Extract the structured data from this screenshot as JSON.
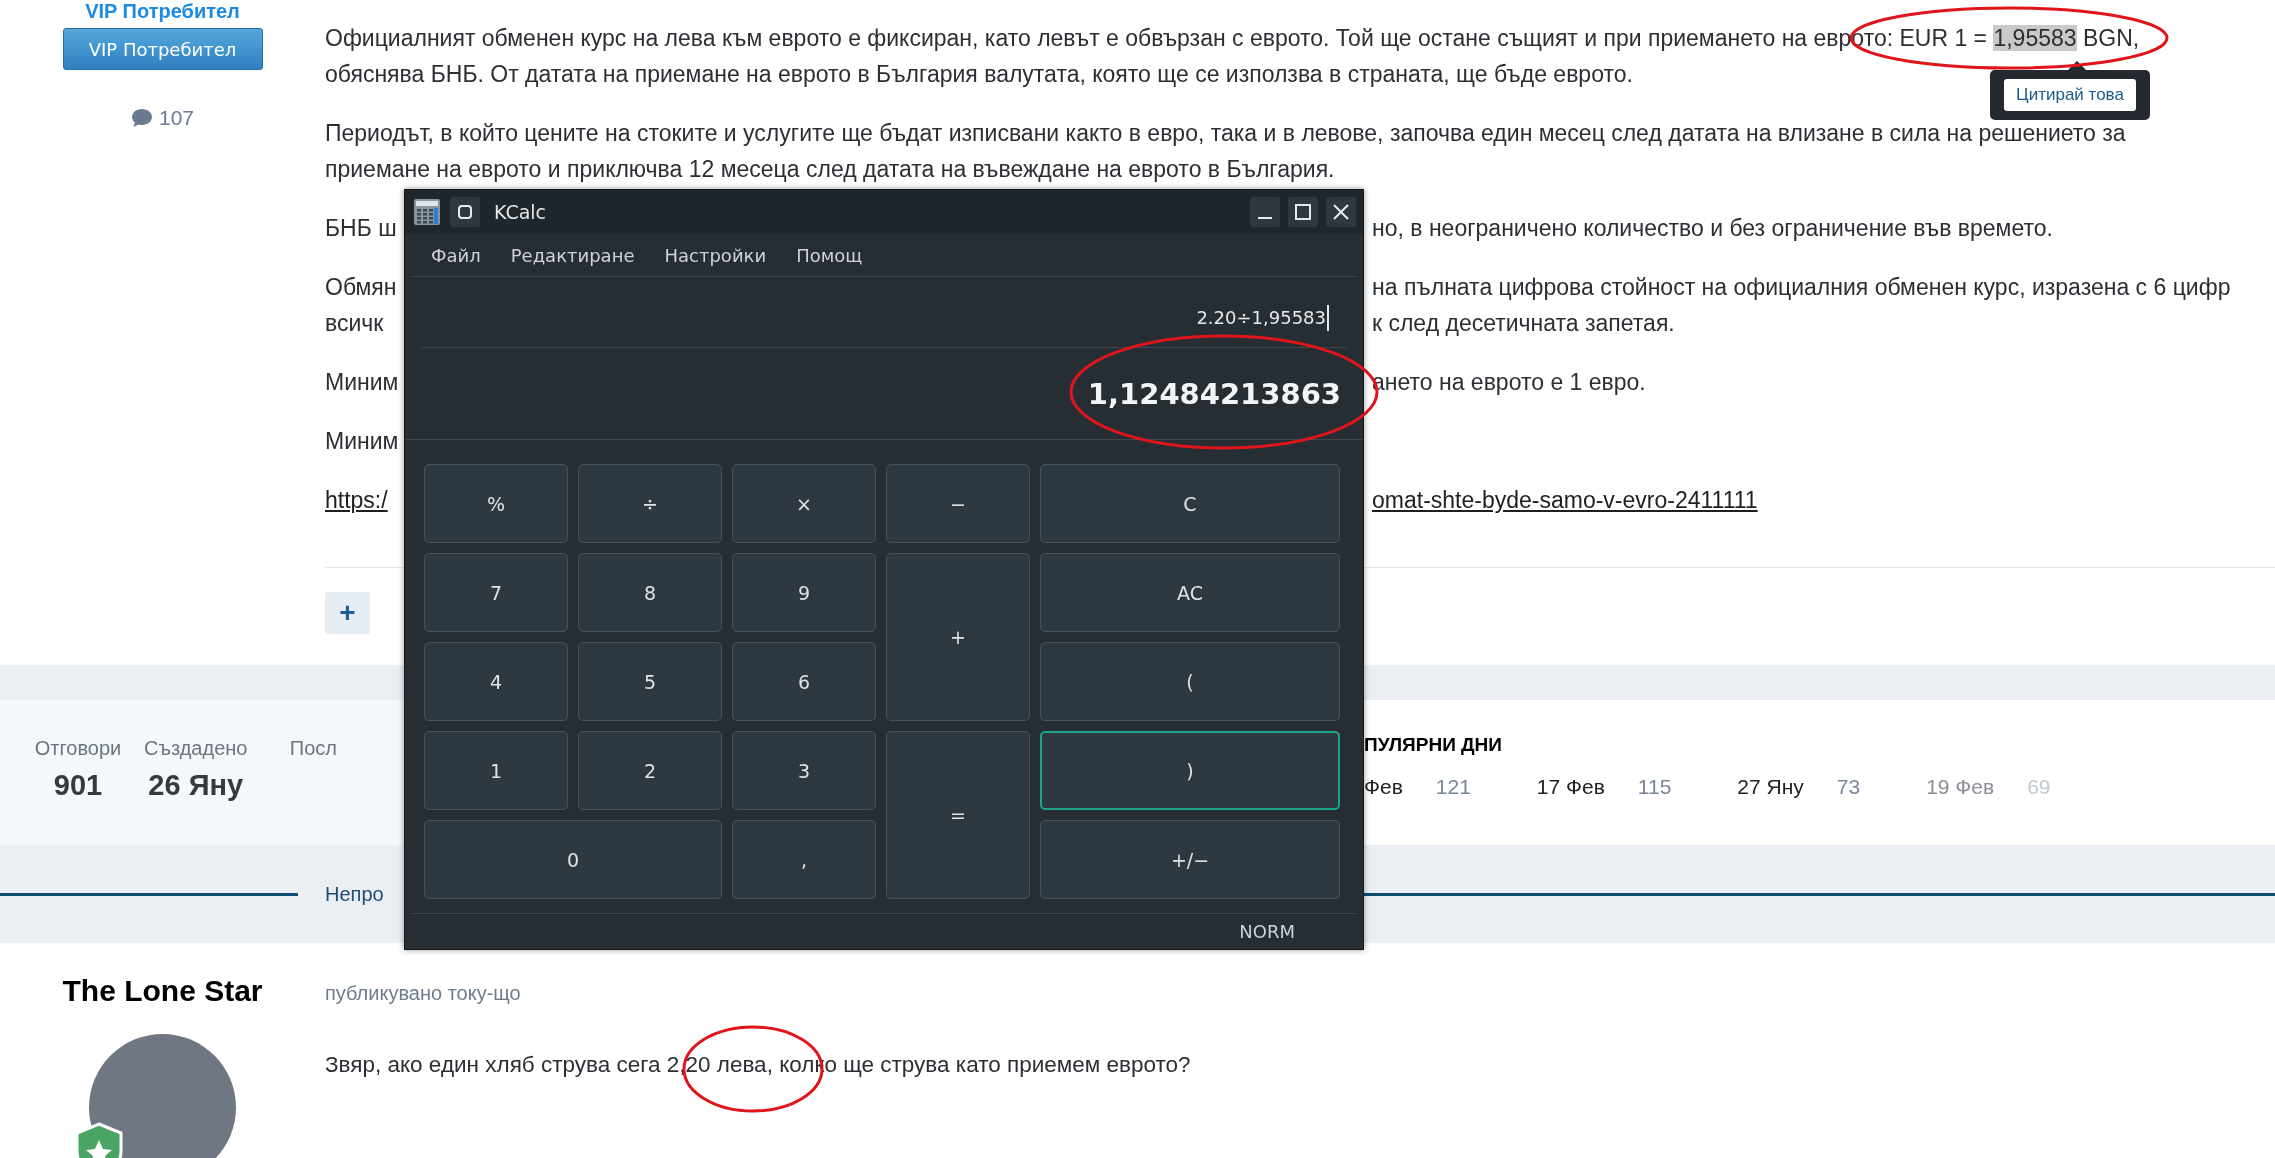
{
  "sidebar": {
    "rank_title": "VIP Потребител",
    "rank_badge": "VIP Потребител",
    "comment_count": "107"
  },
  "article": {
    "paragraphs": [
      {
        "lines": [
          {
            "kind": "highlighted",
            "text": "Официалният обменен курс на лева към еврото е фиксиран, като левът е обвързан с еврото. Той ще остане същият и при приемането на еврото: EUR 1 = ",
            "highlight": "1,95583",
            "after": " BGN,"
          },
          {
            "kind": "full",
            "text": "обяснява БНБ. От датата на приемане на еврото в България валутата, която ще се използва в страната, ще бъде еврото."
          }
        ]
      },
      {
        "lines": [
          {
            "kind": "full",
            "text": "Периодът, в който цените на стоките и услугите ще бъдат изписвани както в евро, така и в левове, започва един месец след датата на влизане в сила на решението за"
          },
          {
            "kind": "full",
            "text": "приемане на еврото и приключва 12 месеца след датата на въвеждане на еврото в България."
          }
        ]
      },
      {
        "lines": [
          {
            "kind": "split",
            "left": "БНБ ш",
            "right": "но, в неограничено количество и без ограничение във времето."
          }
        ]
      },
      {
        "lines": [
          {
            "kind": "split",
            "left": "Обмян",
            "right": "на пълната цифрова стойност на официалния обменен курс, изразена с 6 цифр"
          },
          {
            "kind": "split",
            "left": "всичк",
            "right": "к след десетичната запетая."
          }
        ]
      },
      {
        "lines": [
          {
            "kind": "split",
            "left": "Миним",
            "right": "ането на еврото е 1 евро."
          }
        ]
      },
      {
        "lines": [
          {
            "kind": "split",
            "left": "Миним"
          }
        ]
      },
      {
        "lines": [
          {
            "kind": "link",
            "left": "https:/",
            "right": "omat-shte-byde-samo-v-evro-2411111"
          }
        ]
      }
    ],
    "add_button": "+"
  },
  "quote_tooltip": {
    "button": "Цитирай това"
  },
  "stats": [
    {
      "label": "Отговори",
      "value": "901"
    },
    {
      "label": "Създадено",
      "value": "26 Яну"
    },
    {
      "label": "Посл"
    }
  ],
  "popular_days": {
    "title": "ПУЛЯРНИ ДНИ",
    "days": [
      {
        "date": "Фев",
        "count": "121"
      },
      {
        "date": "17 Фев",
        "count": "115"
      },
      {
        "date": "27 Яну",
        "count": "73"
      },
      {
        "date": "19 Фев",
        "count": "69"
      }
    ]
  },
  "tab": {
    "label": "Непро"
  },
  "reply": {
    "author": "The Lone Star",
    "time": "публикувано току-що",
    "text": "Звяр, ако един хляб струва сега 2,20 лева, колко ще струва като приемем еврото?"
  },
  "calculator": {
    "title": "KCalc",
    "menu": [
      "Файл",
      "Редактиране",
      "Настройки",
      "Помощ"
    ],
    "expression": "2.20÷1,95583",
    "result": "1,12484213863",
    "keys": [
      {
        "label": "%",
        "kind": "normal",
        "focused": false
      },
      {
        "label": "÷",
        "kind": "normal",
        "focused": false
      },
      {
        "label": "×",
        "kind": "normal",
        "focused": false
      },
      {
        "label": "−",
        "kind": "normal",
        "focused": false
      },
      {
        "label": "C",
        "kind": "normal",
        "focused": false
      },
      {
        "label": "7",
        "kind": "normal",
        "focused": false
      },
      {
        "label": "8",
        "kind": "normal",
        "focused": false
      },
      {
        "label": "9",
        "kind": "normal",
        "focused": false
      },
      {
        "label": "+",
        "kind": "tall",
        "focused": false
      },
      {
        "label": "AC",
        "kind": "normal",
        "focused": false
      },
      {
        "label": "4",
        "kind": "normal",
        "focused": false
      },
      {
        "label": "5",
        "kind": "normal",
        "focused": false
      },
      {
        "label": "6",
        "kind": "normal",
        "focused": false
      },
      {
        "label": "(",
        "kind": "normal",
        "focused": false
      },
      {
        "label": "1",
        "kind": "normal",
        "focused": false
      },
      {
        "label": "2",
        "kind": "normal",
        "focused": false
      },
      {
        "label": "3",
        "kind": "normal",
        "focused": false
      },
      {
        "label": "=",
        "kind": "tall",
        "focused": false
      },
      {
        "label": ")",
        "kind": "normal",
        "focused": true
      },
      {
        "label": "0",
        "kind": "wide",
        "focused": false
      },
      {
        "label": ",",
        "kind": "normal",
        "focused": false
      },
      {
        "label": "+/−",
        "kind": "normal",
        "focused": false
      }
    ],
    "status": "NORM"
  }
}
